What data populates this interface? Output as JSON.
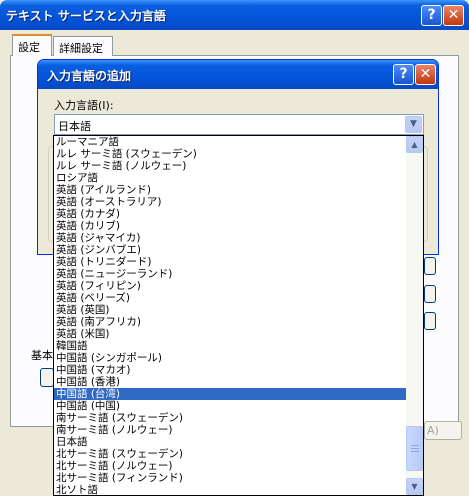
{
  "outer_window": {
    "title": "テキスト サービスと入力言語",
    "help_glyph": "?",
    "close_glyph": "✕",
    "tabs": [
      {
        "label": "設定",
        "active": true
      },
      {
        "label": "詳細設定",
        "active": false
      }
    ],
    "fragments": {
      "group_label_part": "基本",
      "apply_button_part": "A)"
    }
  },
  "dialog": {
    "title": "入力言語の追加",
    "help_glyph": "?",
    "close_glyph": "✕",
    "input_language_label": "入力言語(I):",
    "selected_language": "日本語",
    "dropdown_arrow": "▼"
  },
  "language_list": {
    "items": [
      "ルーマニア語",
      "ルレ サーミ語 (スウェーデン)",
      "ルレ サーミ語 (ノルウェー)",
      "ロシア語",
      "英語 (アイルランド)",
      "英語 (オーストラリア)",
      "英語 (カナダ)",
      "英語 (カリブ)",
      "英語 (ジャマイカ)",
      "英語 (ジンバブエ)",
      "英語 (トリニダード)",
      "英語 (ニュージーランド)",
      "英語 (フィリピン)",
      "英語 (ベリーズ)",
      "英語 (英国)",
      "英語 (南アフリカ)",
      "英語 (米国)",
      "韓国語",
      "中国語 (シンガポール)",
      "中国語 (マカオ)",
      "中国語 (香港)",
      "中国語 (台湾)",
      "中国語 (中国)",
      "南サーミ語 (スウェーデン)",
      "南サーミ語 (ノルウェー)",
      "日本語",
      "北サーミ語 (スウェーデン)",
      "北サーミ語 (ノルウェー)",
      "北サーミ語 (フィンランド)",
      "北ソト語"
    ],
    "selected_index": 21,
    "scroll_up_glyph": "▲",
    "scroll_down_glyph": "▼",
    "scroll_position": 0.88
  },
  "colors": {
    "selection": "#316ac5",
    "title_bar": "#0454d9",
    "dialog_face": "#ece9d8"
  }
}
